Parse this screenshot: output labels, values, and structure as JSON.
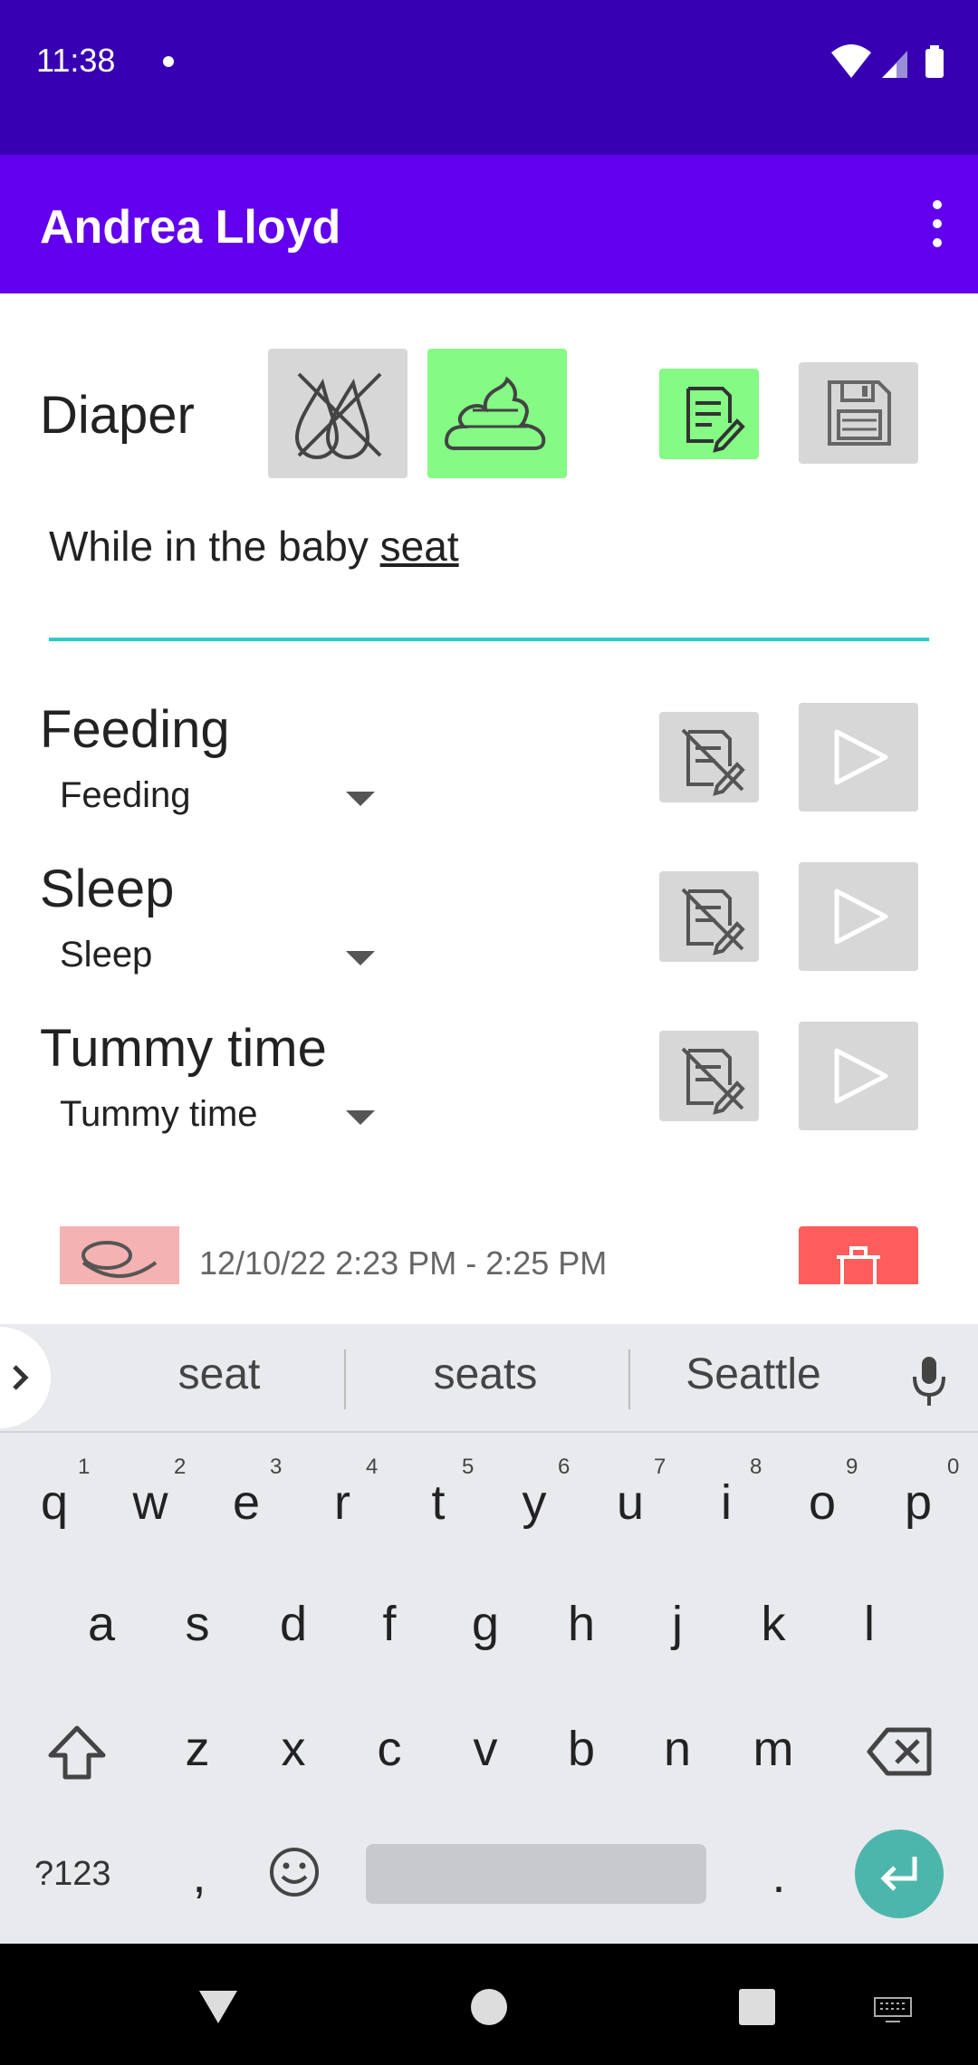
{
  "status_bar": {
    "time": "11:38"
  },
  "app_bar": {
    "title": "Andrea Lloyd"
  },
  "diaper": {
    "label": "Diaper",
    "note_value": "While in the baby seat",
    "note_value_main": "While in the baby ",
    "note_value_underlined": "seat"
  },
  "activities": [
    {
      "label": "Feeding",
      "dropdown": "Feeding"
    },
    {
      "label": "Sleep",
      "dropdown": "Sleep"
    },
    {
      "label": "Tummy time",
      "dropdown": "Tummy time"
    }
  ],
  "history": [
    {
      "text": "12/10/22  2:23 PM - 2:25 PM"
    }
  ],
  "keyboard": {
    "suggestions": [
      "seat",
      "seats",
      "Seattle"
    ],
    "row1": [
      "q",
      "w",
      "e",
      "r",
      "t",
      "y",
      "u",
      "i",
      "o",
      "p"
    ],
    "row1_hints": [
      "1",
      "2",
      "3",
      "4",
      "5",
      "6",
      "7",
      "8",
      "9",
      "0"
    ],
    "row2": [
      "a",
      "s",
      "d",
      "f",
      "g",
      "h",
      "j",
      "k",
      "l"
    ],
    "row3": [
      "z",
      "x",
      "c",
      "v",
      "b",
      "n",
      "m"
    ],
    "symbols_key": "?123",
    "comma": ",",
    "period": "."
  },
  "colors": {
    "status_bar": "#3700b3",
    "app_bar": "#6200ee",
    "active_green": "#85fa85",
    "delete_red": "#ff5c5c",
    "underline_teal": "#2fc8c8",
    "enter_key": "#4db6ac"
  }
}
